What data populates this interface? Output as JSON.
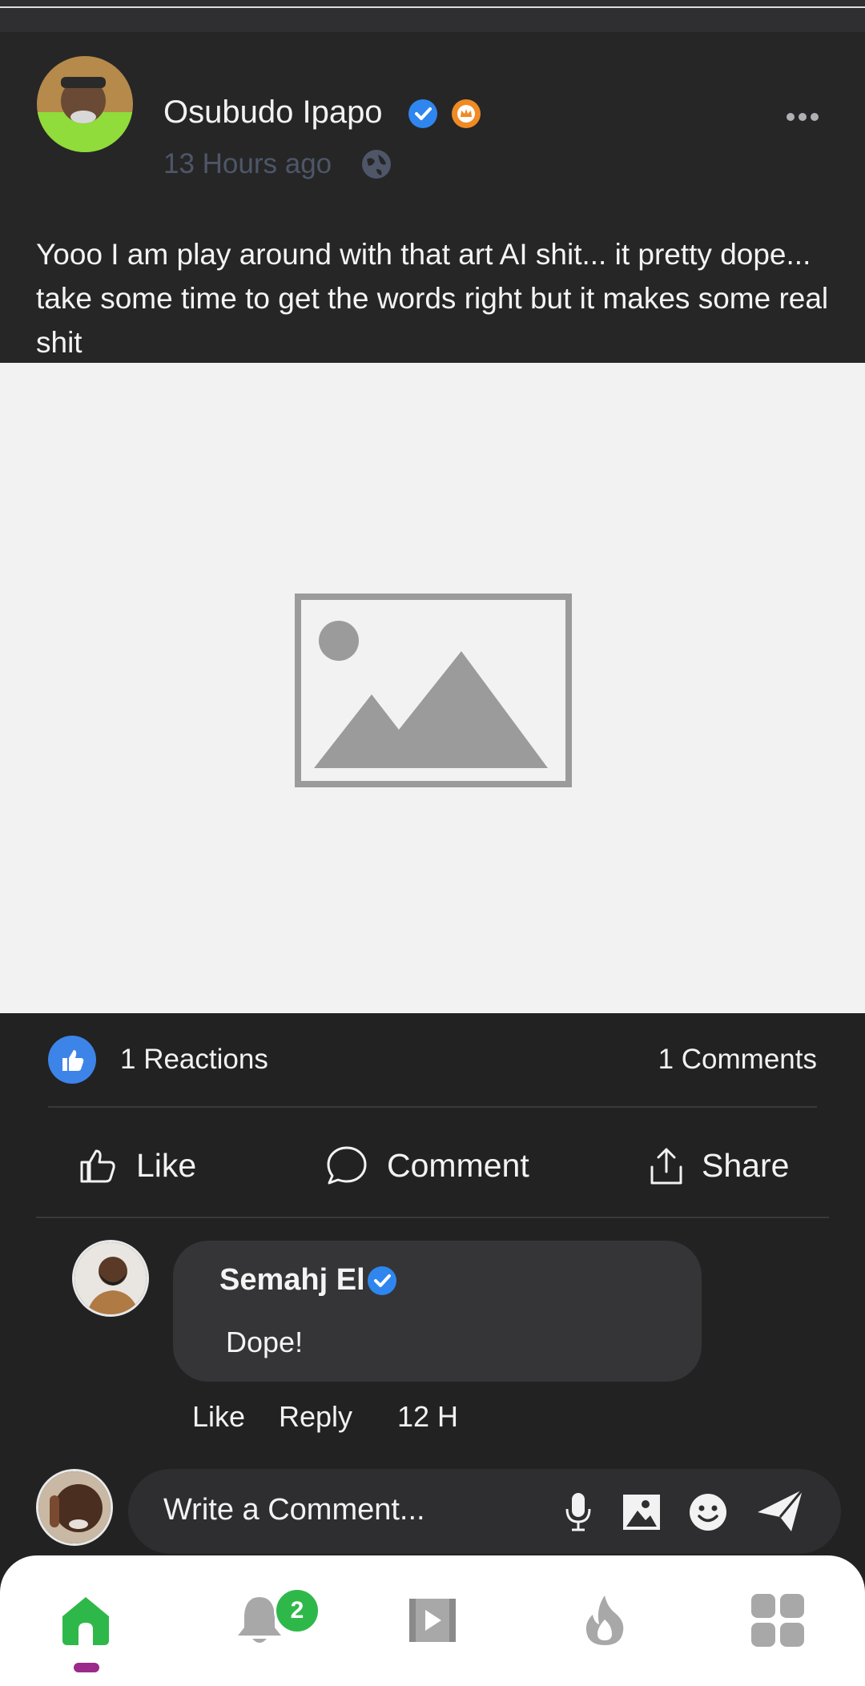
{
  "post": {
    "author_name": "Osubudo Ipapo",
    "timestamp": "13 Hours ago",
    "privacy_icon": "globe-icon",
    "text": "Yooo I am play around with that art AI shit... it pretty dope... take some time to get the words right but it makes some real shit",
    "image_state": "placeholder",
    "reactions_label": "1 Reactions",
    "comments_label": "1 Comments"
  },
  "actions": {
    "like_label": "Like",
    "comment_label": "Comment",
    "share_label": "Share"
  },
  "comment": {
    "author_name": "Semahj El",
    "text": "Dope!",
    "like_label": "Like",
    "reply_label": "Reply",
    "time": "12 H"
  },
  "composer": {
    "placeholder": "Write a Comment..."
  },
  "nav": {
    "notifications_badge": "2",
    "active_tab": "home"
  },
  "colors": {
    "background": "#222223",
    "verified_blue": "#2f86ef",
    "nav_active_green": "#2fb84a",
    "nav_indicator": "#9b2a8a"
  }
}
